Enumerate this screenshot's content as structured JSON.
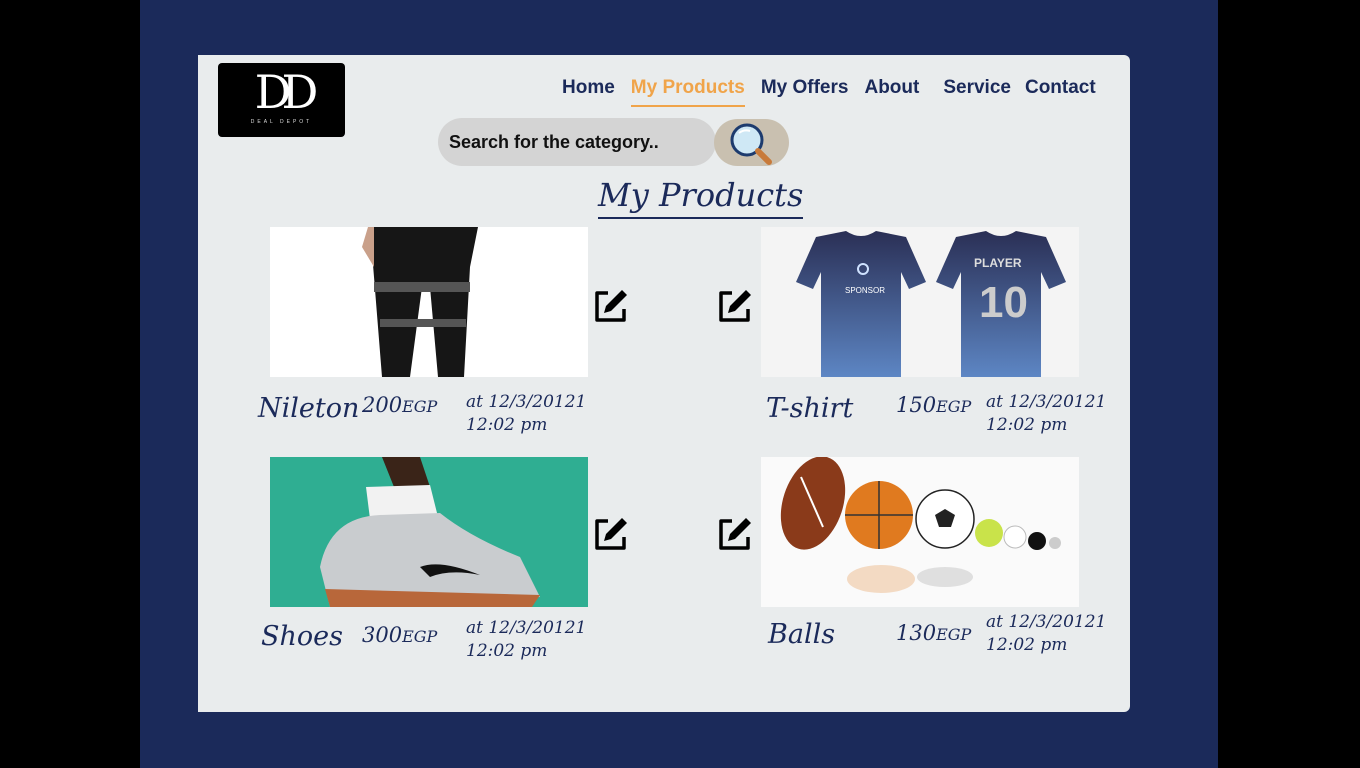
{
  "brand": {
    "logo_text": "DD",
    "logo_subtext": "DEAL DEPOT"
  },
  "nav": {
    "items": [
      {
        "label": "Home",
        "active": false
      },
      {
        "label": "My Products",
        "active": true
      },
      {
        "label": "My Offers",
        "active": false
      },
      {
        "label": "About",
        "active": false
      },
      {
        "label": "Service",
        "active": false
      },
      {
        "label": "Contact",
        "active": false
      }
    ]
  },
  "search": {
    "placeholder": "Search for the category.."
  },
  "page": {
    "title": "My Products"
  },
  "products": [
    {
      "name": "Nileton",
      "price": "200",
      "currency": "EGP",
      "date": "at 12/3/20121",
      "time": "12:02 pm",
      "image": "leggings"
    },
    {
      "name": "T-shirt",
      "price": "150",
      "currency": "EGP",
      "date": "at 12/3/20121",
      "time": "12:02 pm",
      "image": "jersey"
    },
    {
      "name": "Shoes",
      "price": "300",
      "currency": "EGP",
      "date": "at 12/3/20121",
      "time": "12:02 pm",
      "image": "sneaker"
    },
    {
      "name": "Balls",
      "price": "130",
      "currency": "EGP",
      "date": "at 12/3/20121",
      "time": "12:02 pm",
      "image": "balls"
    }
  ],
  "colors": {
    "navy": "#1b2a5a",
    "accent": "#f0a44a",
    "card": "#e9eced"
  }
}
